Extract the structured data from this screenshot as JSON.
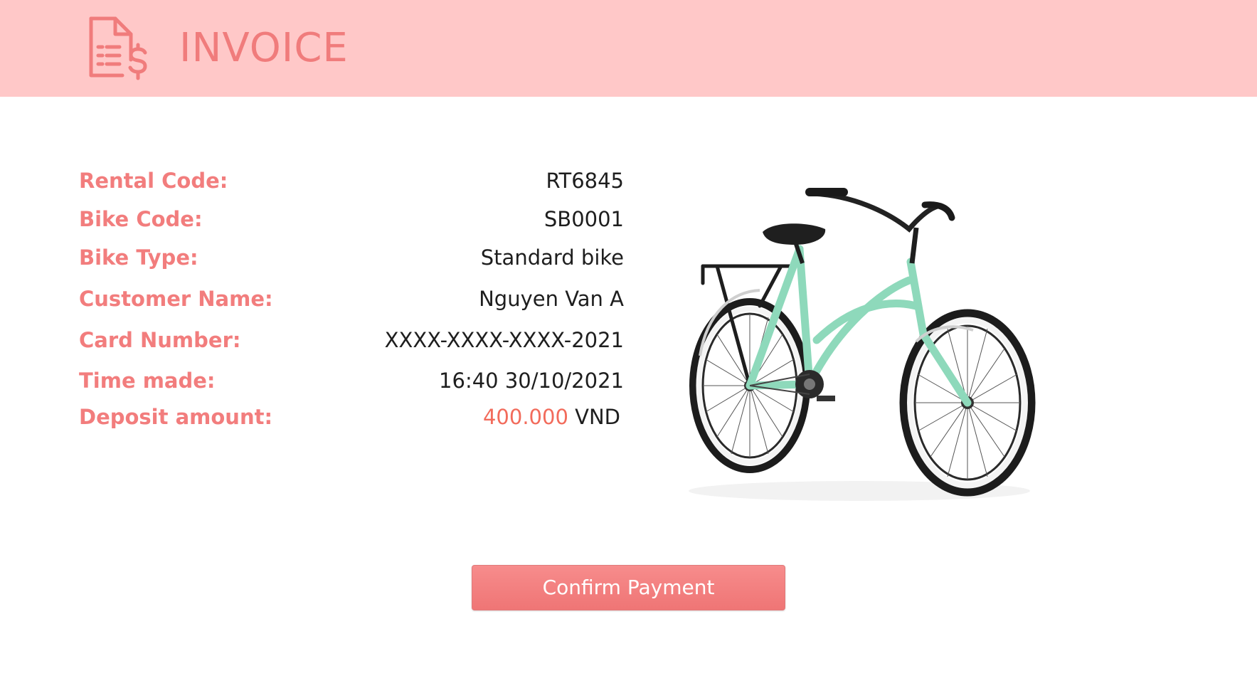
{
  "header": {
    "title": "INVOICE",
    "icon": "invoice-dollar-icon",
    "background": "#ffc8c8",
    "accent": "#f07c7c"
  },
  "invoice": {
    "rows": [
      {
        "label": "Rental Code:",
        "value": "RT6845"
      },
      {
        "label": "Bike Code:",
        "value": "SB0001"
      },
      {
        "label": "Bike Type:",
        "value": "Standard bike"
      },
      {
        "label": "Customer Name:",
        "value": "Nguyen Van A"
      },
      {
        "label": "Card Number:",
        "value": "XXXX-XXXX-XXXX-2021"
      },
      {
        "label": "Time made:",
        "value": "16:40 30/10/2021"
      }
    ],
    "deposit": {
      "label": "Deposit amount:",
      "amount": "400.000",
      "currency": "VND"
    }
  },
  "bike_image": {
    "icon": "bike-photo"
  },
  "actions": {
    "confirm_label": "Confirm Payment"
  }
}
